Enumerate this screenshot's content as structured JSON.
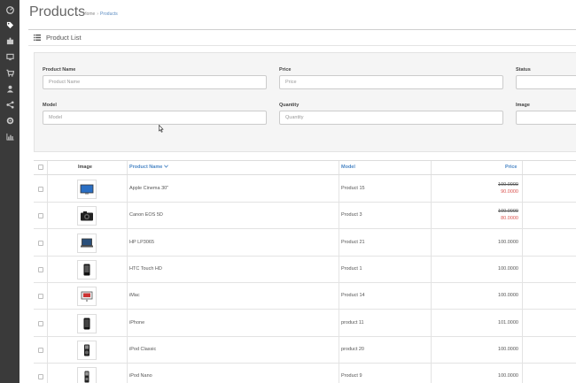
{
  "header": {
    "title": "Products",
    "breadcrumb": [
      "Home",
      "Products"
    ]
  },
  "panel": {
    "title": "Product List",
    "icon": "list-icon"
  },
  "filter": {
    "product_name": {
      "label": "Product Name",
      "placeholder": "Product Name"
    },
    "price": {
      "label": "Price",
      "placeholder": "Price"
    },
    "status": {
      "label": "Status"
    },
    "model": {
      "label": "Model",
      "placeholder": "Model"
    },
    "quantity": {
      "label": "Quantity",
      "placeholder": "Quantity"
    },
    "image": {
      "label": "Image"
    }
  },
  "table": {
    "headers": {
      "image": "Image",
      "product_name": "Product Name",
      "model": "Model",
      "price": "Price"
    },
    "rows": [
      {
        "name": "Apple Cinema 30\"",
        "model": "Product 15",
        "price": "100.0000",
        "special": "90.0000",
        "icon": "monitor-icon"
      },
      {
        "name": "Canon EOS 5D",
        "model": "Product 3",
        "price": "100.0000",
        "special": "80.0000",
        "icon": "camera-icon"
      },
      {
        "name": "HP LP3065",
        "model": "Product 21",
        "price": "100.0000",
        "icon": "laptop-icon"
      },
      {
        "name": "HTC Touch HD",
        "model": "Product 1",
        "price": "100.0000",
        "icon": "phone-icon"
      },
      {
        "name": "iMac",
        "model": "Product 14",
        "price": "100.0000",
        "icon": "imac-icon"
      },
      {
        "name": "iPhone",
        "model": "product 11",
        "price": "101.0000",
        "icon": "iphone-icon"
      },
      {
        "name": "iPod Classic",
        "model": "product 20",
        "price": "100.0000",
        "icon": "ipod-icon"
      },
      {
        "name": "iPod Nano",
        "model": "Product 9",
        "price": "100.0000",
        "icon": "ipod-nano-icon"
      }
    ]
  },
  "sidebar": {
    "items": [
      "dashboard-icon",
      "tag-icon",
      "puzzle-icon",
      "desktop-icon",
      "cart-icon",
      "user-icon",
      "share-icon",
      "gear-icon",
      "chart-icon"
    ]
  },
  "colors": {
    "sidebar": "#3a3a3a",
    "link": "#4a86c5",
    "special_price": "#d9534f"
  }
}
